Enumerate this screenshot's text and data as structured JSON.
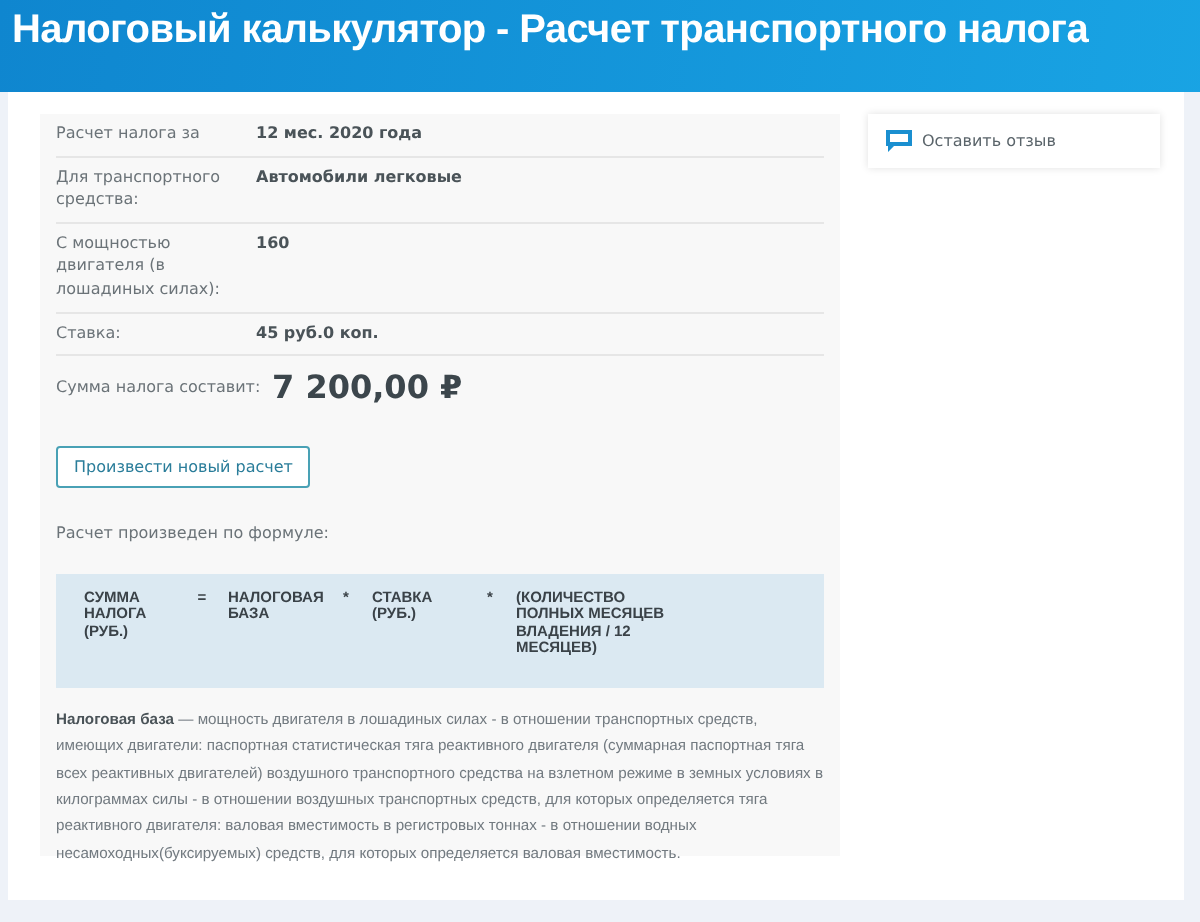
{
  "header": {
    "title": "Налоговый калькулятор - Расчет транспортного налога"
  },
  "result": {
    "rows": [
      {
        "label": "Расчет налога за",
        "value": "12 мес. 2020 года"
      },
      {
        "label": "Для транспортного средства:",
        "value": "Автомобили легковые"
      },
      {
        "label": "С мощностью двигателя (в лошадиных силах):",
        "value": "160"
      },
      {
        "label": "Ставка:",
        "value": "45 руб.0 коп."
      }
    ],
    "total": {
      "label": "Сумма налога составит:",
      "value": "7 200,00 ₽"
    },
    "new_calc_button": "Произвести новый расчет",
    "formula_caption": "Расчет произведен по формуле:",
    "formula": [
      {
        "kind": "term",
        "text": "СУММА НАЛОГА (РУБ.)"
      },
      {
        "kind": "operator",
        "text": "="
      },
      {
        "kind": "term",
        "text": "НАЛОГОВАЯ БАЗА"
      },
      {
        "kind": "operator",
        "text": "*"
      },
      {
        "kind": "term",
        "text": "СТАВКА (РУБ.)"
      },
      {
        "kind": "operator",
        "text": "*"
      },
      {
        "kind": "term",
        "text": "(КОЛИЧЕСТВО ПОЛНЫХ МЕСЯЦЕВ ВЛАДЕНИЯ / 12 МЕСЯЦЕВ)"
      }
    ],
    "description": "**Налоговая база** — мощность двигателя в лошадиных силах - в отношении транспортных средств, имеющих двигатели: паспортная статистическая тяга реактивного двигателя (суммарная паспортная тяга всех реактивных двигателей) воздушного транспортного средства на взлетном режиме в земных условиях в килограммах силы - в отношении воздушных транспортных средств, для которых определяется тяга реактивного двигателя: валовая вместимость в регистровых тоннах - в отношении водных несамоходных(буксируемых) средств, для которых определяется валовая вместимость."
  },
  "sidebar": {
    "feedback_link": "Оставить отзыв"
  }
}
